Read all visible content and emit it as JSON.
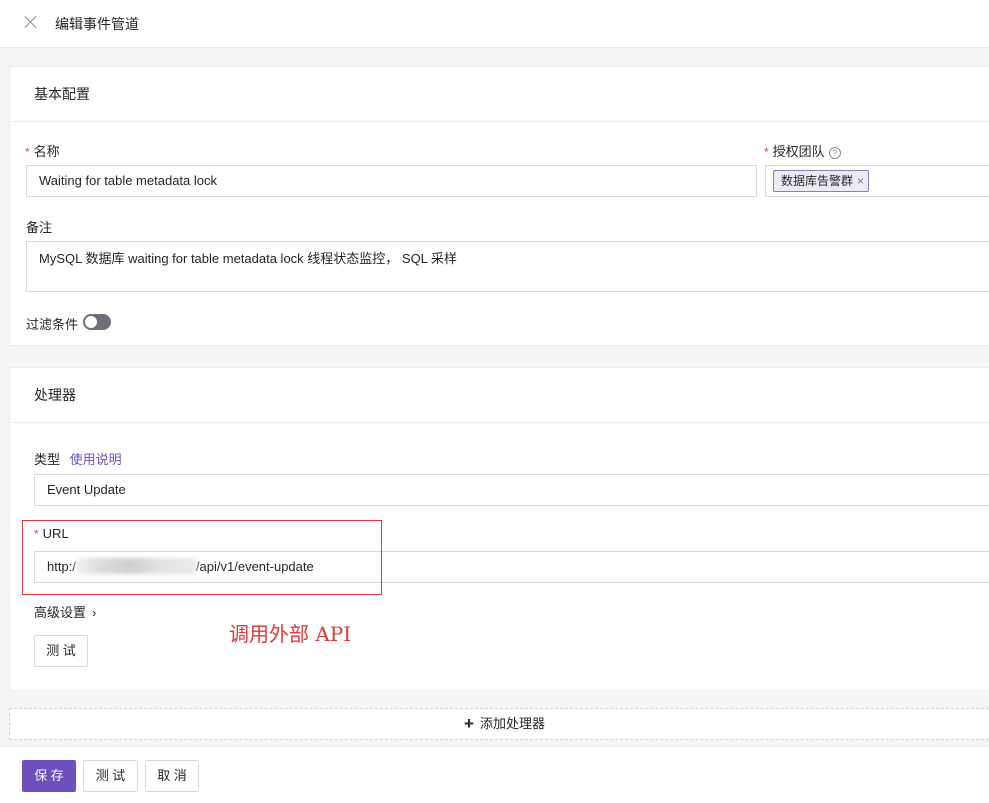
{
  "header": {
    "title": "编辑事件管道"
  },
  "basic": {
    "title": "基本配置",
    "name_label": "名称",
    "name_value": "Waiting for table metadata lock",
    "team_label": "授权团队",
    "team_tag": "数据库告警群",
    "note_label": "备注",
    "note_value": "MySQL 数据库 waiting for table metadata lock 线程状态监控， SQL 采样",
    "filter_label": "过滤条件",
    "filter_enabled": false
  },
  "processor": {
    "title": "处理器",
    "type_label": "类型",
    "type_help_link": "使用说明",
    "type_value": "Event Update",
    "url_label": "URL",
    "url_prefix": "http:/",
    "url_suffix": "/api/v1/event-update",
    "advanced_label": "高级设置",
    "test_label": "测 试"
  },
  "annotation": {
    "text": "调用外部 API",
    "color": "#e03a3a"
  },
  "add_processor_label": "添加处理器",
  "footer": {
    "save_label": "保 存",
    "test_label": "测 试",
    "cancel_label": "取 消"
  },
  "colors": {
    "accent": "#6e4fbd",
    "required": "#e5484d"
  }
}
